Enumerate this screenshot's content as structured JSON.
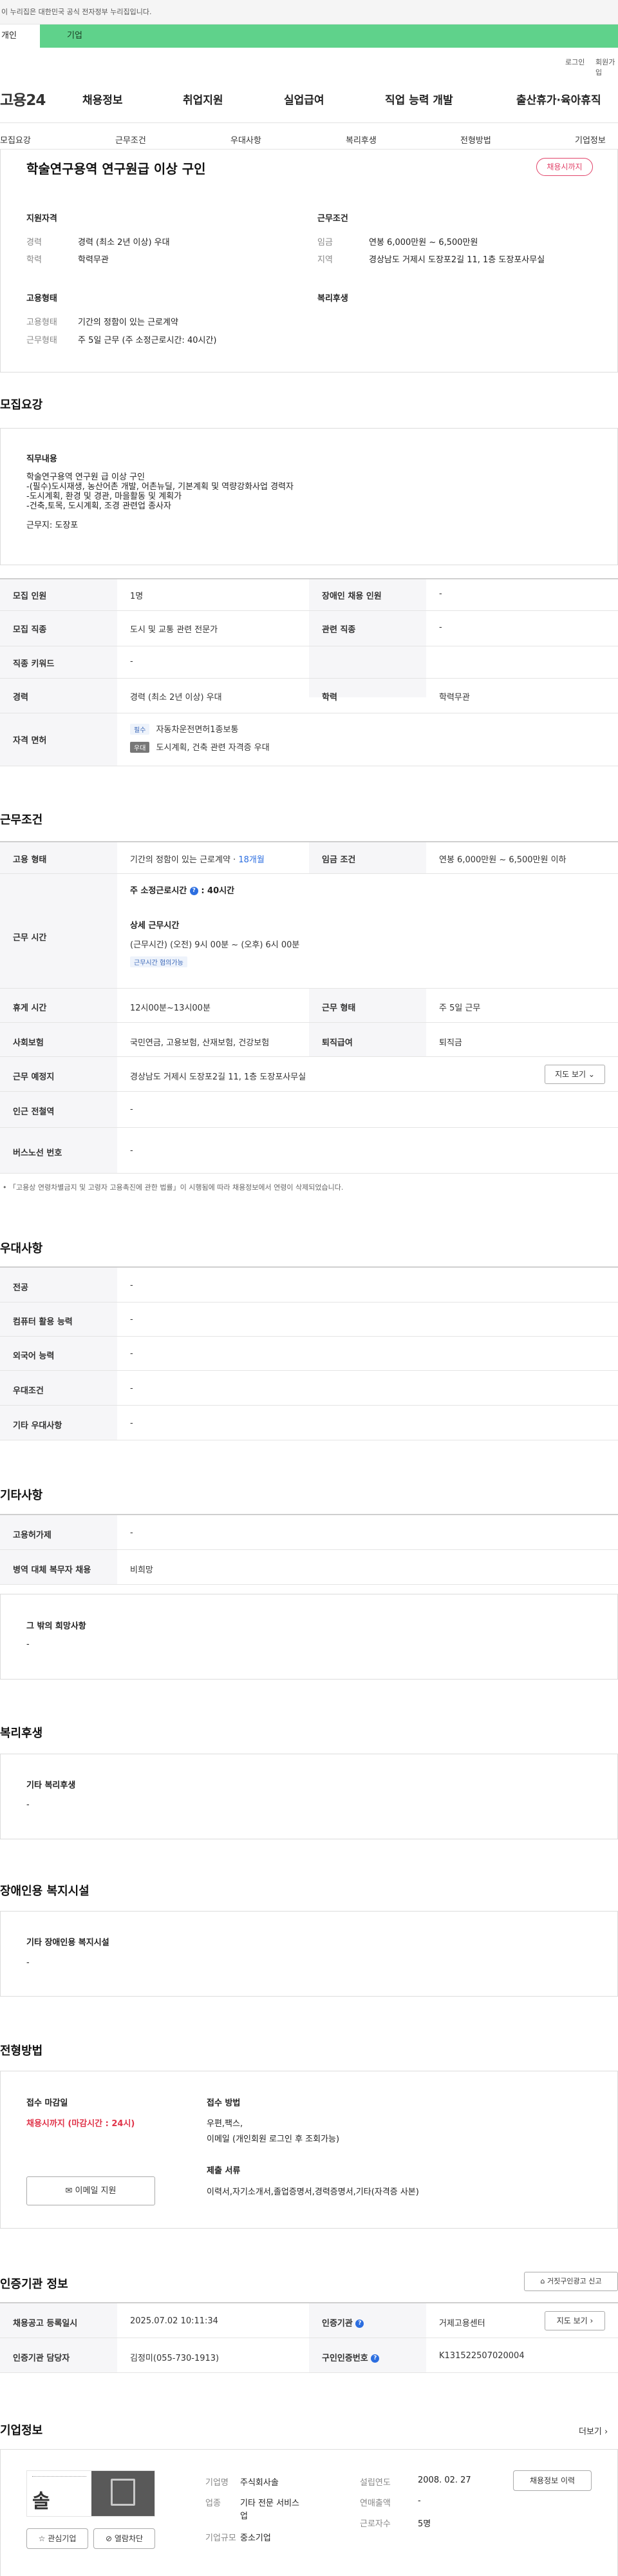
{
  "gov_banner": "이 누리집은 대한민국 공식 전자정부 누리집입니다.",
  "tabs": [
    "개인",
    "기업"
  ],
  "util": [
    "로그인",
    "회원가입"
  ],
  "logo": "고용24",
  "gnb": [
    "채용정보",
    "취업지원",
    "실업급여",
    "직업 능력 개발",
    "출산휴가·육아휴직"
  ],
  "subnav": [
    "모집요강",
    "근무조건",
    "우대사항",
    "복리후생",
    "전형방법",
    "기업정보"
  ],
  "job": {
    "title": "학술연구용역 연구원급 이상 구인",
    "badge": "채용시까지",
    "qual_h": "지원자격",
    "exp_l": "경력",
    "exp_v": "경력 (최소 2년 이상) 우대",
    "edu_l": "학력",
    "edu_v": "학력무관",
    "cond_h": "근무조건",
    "wage_l": "임금",
    "wage_v": "연봉 6,000만원 ~ 6,500만원",
    "region_l": "지역",
    "region_v": "경상남도 거제시 도장포2길 11, 1층 도장포사무실",
    "emp_h": "고용형태",
    "type_l": "고용형태",
    "type_v": "기간의 정함이 있는 근로계약",
    "wt_l": "근무형태",
    "wt_v": "주 5일 근무 (주 소정근로시간: 40시간)",
    "welfare_h": "복리후생"
  },
  "recruit": {
    "title": "모집요강",
    "duty_h": "직무내용",
    "duty_lines": [
      "학술연구용역 연구원 급 이상 구인",
      "-(필수)도시재생, 농산어촌 개발, 어촌뉴딜, 기본계획 및 역량강화사업 경력자",
      "-도시계획, 환경 및 경관, 마을활동 및 계획가",
      "-건축,토목, 도시계획, 조경 관련업 종사자",
      "",
      "근무지: 도장포"
    ],
    "rows": [
      [
        "모집 인원",
        "1명",
        "장애인 채용 인원",
        "-"
      ],
      [
        "모집 직종",
        "도시 및 교통 관련 전문가",
        "관련 직종",
        "-"
      ],
      [
        "직종 키워드",
        "-",
        "",
        ""
      ],
      [
        "경력",
        "경력 (최소 2년 이상) 우대",
        "학력",
        "학력무관"
      ]
    ],
    "license_l": "자격 면허",
    "lic_tag1": "필수",
    "lic1": "자동차운전면허1종보통",
    "lic_tag2": "우대",
    "lic2": "도시계획, 건축 관련 자격증 우대"
  },
  "work": {
    "title": "근무조건",
    "emp_l": "고용 형태",
    "emp_v": "기간의 정함이 있는 근로계약 · ",
    "emp_v2": "18개월",
    "wage_l": "임금 조건",
    "wage_v": "연봉 6,000만원 ~ 6,500만원 이하",
    "time_l": "근무 시간",
    "week_l": "주 소정근로시간",
    "week_v": ": 40시간",
    "detail_h": "상세 근무시간",
    "detail_v": "(근무시간) (오전) 9시 00분 ~ (오후) 6시 00분",
    "flex_tag": "근무시간 협의가능",
    "rest_l": "휴게 시간",
    "rest_v": "12시00분~13시00분",
    "form_l": "근무 형태",
    "form_v": "주 5일 근무",
    "ins_l": "사회보험",
    "ins_v": "국민연금, 고용보험, 산재보험, 건강보험",
    "ret_l": "퇴직급여",
    "ret_v": "퇴직금",
    "place_l": "근무 예정지",
    "place_v": "경상남도 거제시 도장포2길 11, 1층 도장포사무실",
    "map_btn": "지도 보기",
    "sub_l": "인근 전철역",
    "sub_v": "-",
    "bus_l": "버스노선 번호",
    "bus_v": "-",
    "note": "「고용상 연령차별금지 및 고령자 고용촉진에 관한 법률」이 시행됨에 따라 채용정보에서 연령이 삭제되었습니다."
  },
  "pref": {
    "title": "우대사항",
    "rows": [
      [
        "전공",
        "-"
      ],
      [
        "컴퓨터 활용 능력",
        "-"
      ],
      [
        "외국어 능력",
        "-"
      ],
      [
        "우대조건",
        "-"
      ],
      [
        "기타 우대사항",
        "-"
      ]
    ]
  },
  "etc": {
    "title": "기타사항",
    "rows": [
      [
        "고용허가제",
        "-"
      ],
      [
        "병역 대체 복무자 채용",
        "비희망"
      ]
    ],
    "hope_h": "그 밖의 희망사항",
    "hope_v": "-"
  },
  "welfare": {
    "title": "복리후생",
    "h": "기타 복리후생",
    "v": "-"
  },
  "disab": {
    "title": "장애인용 복지시설",
    "h": "기타 장애인용 복지시설",
    "v": "-"
  },
  "process": {
    "title": "전형방법",
    "deadline_h": "접수 마감일",
    "deadline_v": "채용시까지 (마감시간 : 24시)",
    "email_btn": "이메일 지원",
    "method_h": "접수 방법",
    "method_v1": "우편,팩스,",
    "method_v2": "이메일 (개인회원 로그인 후 조회가능)",
    "docs_h": "제출 서류",
    "docs_v": "이력서,자기소개서,졸업증명서,경력증명서,기타(자격증 사본)"
  },
  "agency": {
    "title": "인증기관 정보",
    "report_btn": "거짓구인광고 신고",
    "reg_l": "채용공고 등록일시",
    "reg_v": "2025.07.02 10:11:34",
    "ag_l": "인증기관",
    "ag_v": "거제고용센터",
    "map_btn": "지도 보기",
    "mgr_l": "인증기관 담당자",
    "mgr_v": "김정미(055-730-1913)",
    "no_l": "구인인증번호",
    "no_v": "K131522507020004"
  },
  "company": {
    "title": "기업정보",
    "more": "더보기",
    "fav_btn": "관심기업",
    "block_btn": "열람차단",
    "name_l": "기업명",
    "name_v": "주식회사솔",
    "ind_l": "업종",
    "ind_v1": "기타 전문 서비스",
    "ind_v2": "업",
    "size_l": "기업규모",
    "size_v": "중소기업",
    "est_l": "설립연도",
    "est_v": "2008. 02. 27",
    "sales_l": "연매출액",
    "sales_v": "-",
    "emp_l": "근로자수",
    "emp_v": "5명",
    "hire_btn": "채용정보 이력"
  },
  "colors": {
    "tab_green": "#5fd28b",
    "badge_red": "#e2456b",
    "link_blue": "#2c6ee0"
  }
}
